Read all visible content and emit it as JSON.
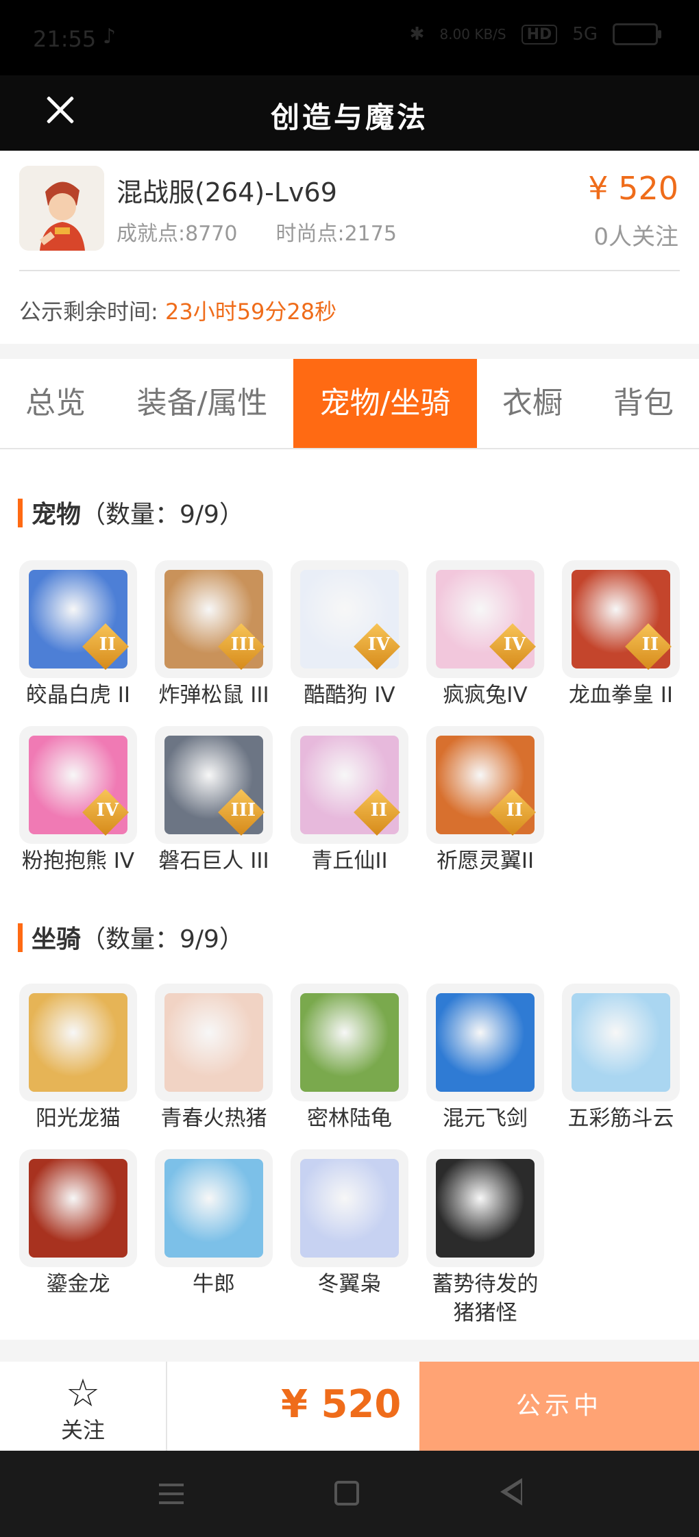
{
  "status_bar": {
    "time": "21:55",
    "network_speed": "8.00 KB/S",
    "hd": "HD",
    "signal": "5G"
  },
  "header": {
    "title": "创造与魔法",
    "close_icon": "close-icon"
  },
  "listing": {
    "server": "混战服(264)-Lv69",
    "achievement": "成就点:8770",
    "fashion": "时尚点:2175",
    "price": "¥ 520",
    "followers": "0人关注",
    "remaining_label": "公示剩余时间:",
    "remaining_value": "23小时59分28秒"
  },
  "tabs": [
    {
      "label": "总览"
    },
    {
      "label": "装备/属性"
    },
    {
      "label": "宠物/坐骑",
      "active": true
    },
    {
      "label": "衣橱"
    },
    {
      "label": "背包"
    }
  ],
  "pets": {
    "title": "宠物",
    "count": "（数量：9/9）",
    "items": [
      {
        "name": "皎晶白虎 II",
        "grade": "II",
        "color": "#4d7fd6"
      },
      {
        "name": "炸弹松鼠 III",
        "grade": "III",
        "color": "#c9925a"
      },
      {
        "name": "酷酷狗 IV",
        "grade": "IV",
        "color": "#e9eef7"
      },
      {
        "name": "疯疯兔IV",
        "grade": "IV",
        "color": "#f2c7dc"
      },
      {
        "name": "龙血拳皇 II",
        "grade": "II",
        "color": "#c4452c"
      },
      {
        "name": "粉抱抱熊 IV",
        "grade": "IV",
        "color": "#f07ab4"
      },
      {
        "name": "磐石巨人 III",
        "grade": "III",
        "color": "#6c7584"
      },
      {
        "name": "青丘仙II",
        "grade": "II",
        "color": "#e7b9dc"
      },
      {
        "name": "祈愿灵翼II",
        "grade": "II",
        "color": "#d8702e"
      }
    ]
  },
  "mounts": {
    "title": "坐骑",
    "count": "（数量：9/9）",
    "items": [
      {
        "name": "阳光龙猫",
        "color": "#e6b456"
      },
      {
        "name": "青春火热猪",
        "color": "#f1d3c4"
      },
      {
        "name": "密林陆龟",
        "color": "#7aa94d"
      },
      {
        "name": "混元飞剑",
        "color": "#2f7bd4"
      },
      {
        "name": "五彩筋斗云",
        "color": "#aad6f1"
      },
      {
        "name": "鎏金龙",
        "color": "#a8321f"
      },
      {
        "name": "牛郎",
        "color": "#7cc0e8"
      },
      {
        "name": "冬翼枭",
        "color": "#c7d2f2"
      },
      {
        "name": "蓄势待发的\n猪猪怪",
        "color": "#2b2b2b"
      }
    ]
  },
  "bottom": {
    "follow_label": "关注",
    "price": "¥ 520",
    "status_button": "公示中"
  },
  "colors": {
    "accent": "#ff6a13",
    "price": "#ef6c1a",
    "status_button": "#ffa374"
  }
}
